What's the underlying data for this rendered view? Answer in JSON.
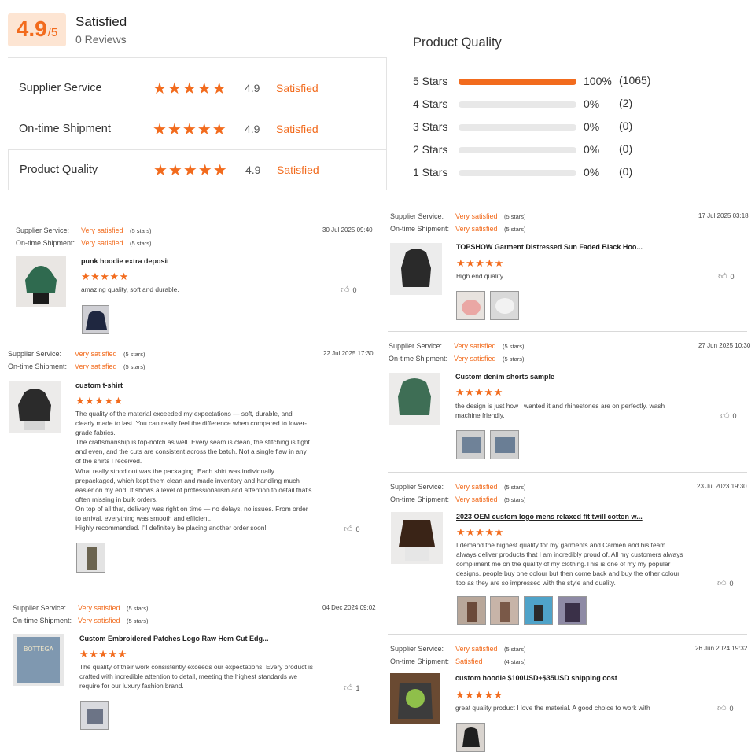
{
  "summary": {
    "score": "4.9",
    "out_of": "/5",
    "label": "Satisfied",
    "reviews": "0 Reviews"
  },
  "ratings": [
    {
      "label": "Supplier Service",
      "stars": "★★★★★",
      "score": "4.9",
      "word": "Satisfied"
    },
    {
      "label": "On-time Shipment",
      "stars": "★★★★★",
      "score": "4.9",
      "word": "Satisfied"
    },
    {
      "label": "Product Quality",
      "stars": "★★★★★",
      "score": "4.9",
      "word": "Satisfied"
    }
  ],
  "product_quality": {
    "title": "Product Quality",
    "rows": [
      {
        "label": "5 Stars",
        "percent": "100%",
        "count": "(1065)",
        "fill_fraction": 1.0
      },
      {
        "label": "4 Stars",
        "percent": "0%",
        "count": "(2)",
        "fill_fraction": 0
      },
      {
        "label": "3 Stars",
        "percent": "0%",
        "count": "(0)",
        "fill_fraction": 0
      },
      {
        "label": "2 Stars",
        "percent": "0%",
        "count": "(0)",
        "fill_fraction": 0
      },
      {
        "label": "1 Stars",
        "percent": "0%",
        "count": "(0)",
        "fill_fraction": 0
      }
    ]
  },
  "meta_labels": {
    "service": "Supplier Service:",
    "shipment": "On-time Shipment:"
  },
  "reviews": [
    {
      "service": "Very satisfied",
      "service_stars": "(5 stars)",
      "shipment": "Very satisfied",
      "shipment_stars": "(5 stars)",
      "date": "30 Jul 2025 09:40",
      "title": "punk hoodie extra deposit",
      "stars": "★★★★★",
      "body": "amazing quality, soft and durable.",
      "likes": "0"
    },
    {
      "service": "Very satisfied",
      "service_stars": "(5 stars)",
      "shipment": "Very satisfied",
      "shipment_stars": "(5 stars)",
      "date": "22 Jul 2025 17:30",
      "title": "custom t-shirt",
      "stars": "★★★★★",
      "body": "The quality of the material exceeded my expectations — soft, durable, and clearly made to last. You can really feel the difference when compared to lower-grade fabrics.\nThe craftsmanship is top-notch as well. Every seam is clean, the stitching is tight and even, and the cuts are consistent across the batch. Not a single flaw in any of the shirts I received.\nWhat really stood out was the packaging. Each shirt was individually prepackaged, which kept them clean and made inventory and handling much easier on my end. It shows a level of professionalism and attention to detail that's often missing in bulk orders.\nOn top of all that, delivery was right on time — no delays, no issues. From order to arrival, everything was smooth and efficient.\nHighly recommended. I'll definitely be placing another order soon!",
      "likes": "0"
    },
    {
      "service": "Very satisfied",
      "service_stars": "(5 stars)",
      "shipment": "Very satisfied",
      "shipment_stars": "(5 stars)",
      "date": "04 Dec 2024 09:02",
      "title": "Custom Embroidered Patches Logo Raw Hem Cut Edg...",
      "stars": "★★★★★",
      "body": "The quality of their work consistently exceeds our expectations. Every product is crafted with incredible attention to detail, meeting the highest standards we require for our luxury fashion brand.",
      "likes": "1"
    },
    {
      "service": "Very satisfied",
      "service_stars": "(5 stars)",
      "shipment": "Very satisfied",
      "shipment_stars": "(5 stars)",
      "date": "17 Jul 2025 03:18",
      "title": "TOPSHOW Garment Distressed Sun Faded Black Hoo...",
      "stars": "★★★★★",
      "body": "High end quality",
      "likes": "0"
    },
    {
      "service": "Very satisfied",
      "service_stars": "(5 stars)",
      "shipment": "Very satisfied",
      "shipment_stars": "(5 stars)",
      "date": "27 Jun 2025 10:30",
      "title": "Custom denim shorts sample",
      "stars": "★★★★★",
      "body": "the design is just how I wanted it and rhinestones are on perfectly. wash machine friendly.",
      "likes": "0"
    },
    {
      "service": "Very satisfied",
      "service_stars": "(5 stars)",
      "shipment": "Very satisfied",
      "shipment_stars": "(5 stars)",
      "date": "23 Jul 2023 19:30",
      "title": "2023 OEM custom logo mens relaxed fit twill cotton w...",
      "stars": "★★★★★",
      "body": "I demand the highest quality for my garments and Carmen and his team always deliver products that I am incredibly proud of. All my customers always compliment me on the quality of my clothing.This is one of my my popular designs, people buy one colour but then come back and buy the other colour too as they are so impressed with the style and quality.",
      "likes": "0"
    },
    {
      "service": "Very satisfied",
      "service_stars": "(5 stars)",
      "shipment": "Satisfied",
      "shipment_stars": "(4 stars)",
      "date": "26 Jun 2024 19:32",
      "title": "custom hoodie $100USD+$35USD shipping cost",
      "stars": "★★★★★",
      "body": "great quality product I love the material. A good choice to work with",
      "likes": "0"
    }
  ],
  "colors": {
    "accent": "#f26b1d",
    "score_bg": "#fde5d3",
    "track": "#e8e8e8"
  },
  "icons": {
    "star": "star-icon",
    "like": "thumbs-up-icon"
  }
}
